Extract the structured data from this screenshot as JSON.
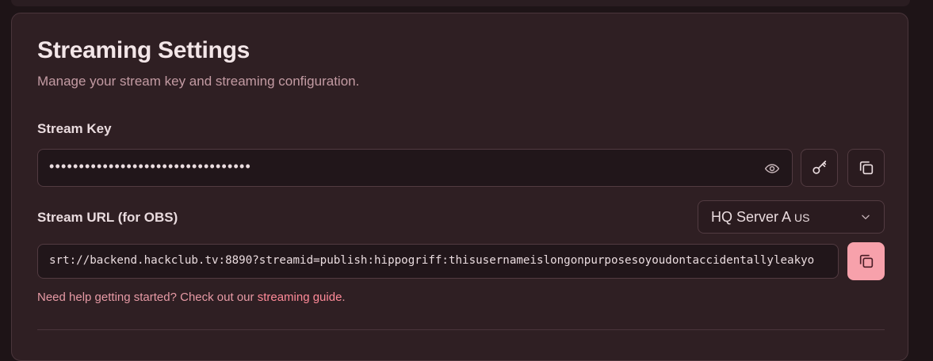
{
  "settings": {
    "title": "Streaming Settings",
    "subtitle": "Manage your stream key and streaming configuration.",
    "stream_key": {
      "label": "Stream Key",
      "masked_value": "••••••••••••••••••••••••••••••••••"
    },
    "stream_url": {
      "label": "Stream URL (for OBS)",
      "value": "srt://backend.hackclub.tv:8890?streamid=publish:hippogriff:thisusernameislongonpurposesoyoudontaccidentallyleakyo"
    },
    "server": {
      "name": "HQ Server A",
      "region": "US"
    },
    "help": {
      "text": "Need help getting started? Check out our ",
      "link": "streaming guide",
      "suffix": "."
    }
  },
  "icons": {
    "show_key": "eye-icon",
    "regenerate_key": "key-icon",
    "copy_key": "copy-icon",
    "server_dropdown": "chevron-down-icon",
    "copy_url": "copy-icon"
  },
  "colors": {
    "background": "#1e1417",
    "card": "#2f1f23",
    "accent": "#f7a1ab",
    "link": "#ff8a98"
  }
}
